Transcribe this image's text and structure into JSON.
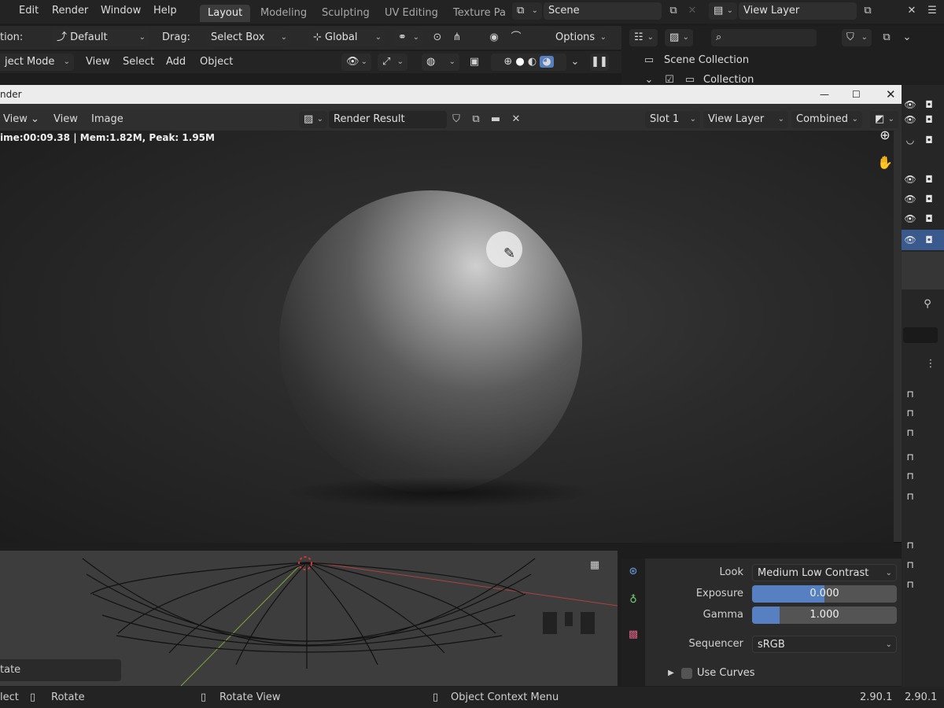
{
  "menubar": {
    "items": [
      "Edit",
      "Render",
      "Window",
      "Help"
    ],
    "workspaces": [
      "Layout",
      "Modeling",
      "Sculpting",
      "UV Editing",
      "Texture Pa"
    ],
    "active_workspace": "Layout",
    "scene": "Scene",
    "view_layer": "View Layer"
  },
  "toolbar": {
    "orientation_label": "tion:",
    "orientation_value": "Default",
    "drag_label": "Drag:",
    "drag_value": "Select Box",
    "transform_value": "Global",
    "options_label": "Options"
  },
  "moderow": {
    "mode": "ject Mode",
    "menus": [
      "View",
      "Select",
      "Add",
      "Object"
    ]
  },
  "outliner": {
    "scene_collection": "Scene Collection",
    "collection": "Collection"
  },
  "render_window": {
    "title": "nder",
    "header_menus": [
      "View",
      "View",
      "Image"
    ],
    "image_name": "Render Result",
    "slot": "Slot 1",
    "view_layer": "View Layer",
    "pass": "Combined",
    "stats": "ime:00:09.38 | Mem:1.82M, Peak: 1.95M"
  },
  "viewport": {
    "tool_label": "tate"
  },
  "properties": {
    "look_label": "Look",
    "look_value": "Medium Low Contrast",
    "exposure_label": "Exposure",
    "exposure_value": "0.000",
    "gamma_label": "Gamma",
    "gamma_value": "1.000",
    "sequencer_label": "Sequencer",
    "sequencer_value": "sRGB",
    "use_curves_label": "Use Curves"
  },
  "statusbar": {
    "select": "lect",
    "rotate": "Rotate",
    "rotate_view": "Rotate View",
    "context_menu": "Object Context Menu",
    "version1": "2.90.1",
    "version2": "2.90.1"
  },
  "colors": {
    "accent": "#5680c2",
    "selected_row": "#3a5a8e"
  }
}
